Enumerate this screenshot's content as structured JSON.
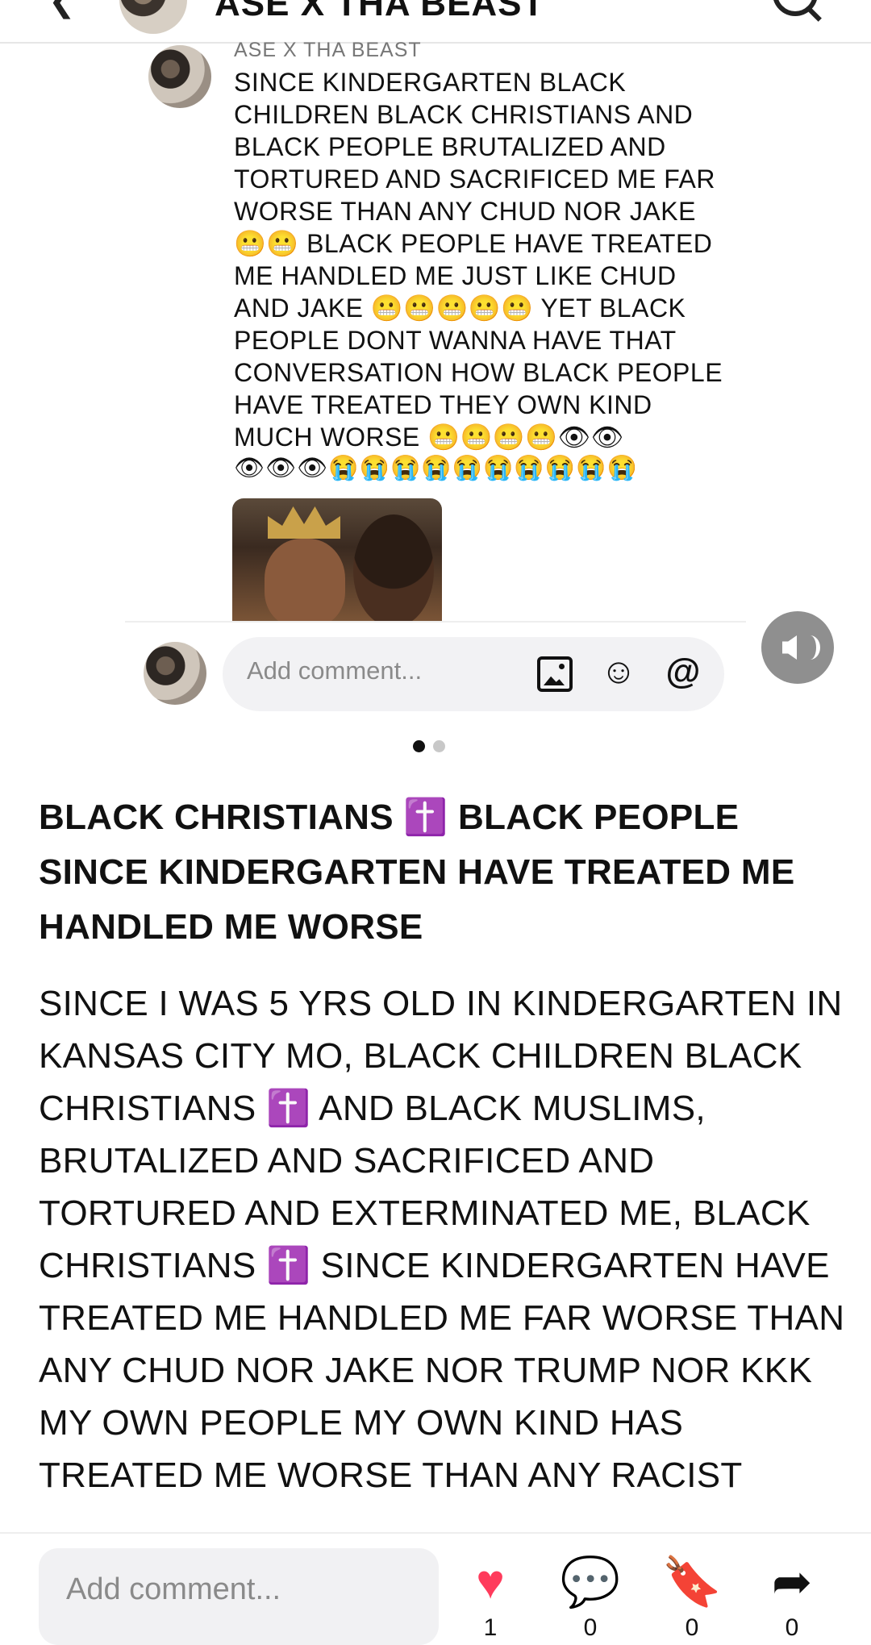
{
  "header": {
    "back_icon": "chevron-left-icon",
    "title": "ASE X THA BEAST",
    "search_icon": "search-icon"
  },
  "comment_sheet": {
    "author": "ASE X THA BEAST",
    "text": "SINCE KINDERGARTEN BLACK CHILDREN BLACK CHRISTIANS AND BLACK PEOPLE BRUTALIZED AND TORTURED AND SACRIFICED ME FAR WORSE THAN ANY CHUD NOR JAKE 😬😬 BLACK PEOPLE HAVE TREATED ME HANDLED ME JUST LIKE CHUD AND JAKE 😬😬😬😬😬 YET BLACK PEOPLE DONT WANNA HAVE THAT CONVERSATION HOW BLACK PEOPLE HAVE TREATED THEY OWN KIND MUCH WORSE 😬😬😬😬👁👁",
    "emoji_line": "👁👁👁😭😭😭😭😭😭😭😭😭😭",
    "comment_placeholder": "Add comment...",
    "icons": [
      "image-icon",
      "sticker-icon",
      "mention-icon"
    ]
  },
  "mute_button_icon": "speaker-icon",
  "carousel": {
    "total": 2,
    "active": 1
  },
  "post": {
    "title": "BLACK CHRISTIANS ✝️ BLACK PEOPLE SINCE KINDERGARTEN HAVE TREATED ME HANDLED ME WORSE",
    "body": "SINCE I WAS 5 YRS OLD IN KINDERGARTEN IN KANSAS CITY MO, BLACK CHILDREN BLACK CHRISTIANS ✝️ AND BLACK MUSLIMS,  BRUTALIZED AND SACRIFICED AND TORTURED AND EXTERMINATED ME, BLACK CHRISTIANS ✝️ SINCE KINDERGARTEN HAVE TREATED ME HANDLED ME FAR WORSE THAN ANY CHUD NOR JAKE NOR TRUMP NOR KKK MY OWN PEOPLE MY OWN KIND HAS TREATED ME WORSE THAN ANY RACIST"
  },
  "bottom_bar": {
    "comment_placeholder": "Add comment...",
    "like_count": "1",
    "comment_count": "0",
    "save_count": "0",
    "share_count": "0",
    "accent_color": "#ff3b5c"
  }
}
